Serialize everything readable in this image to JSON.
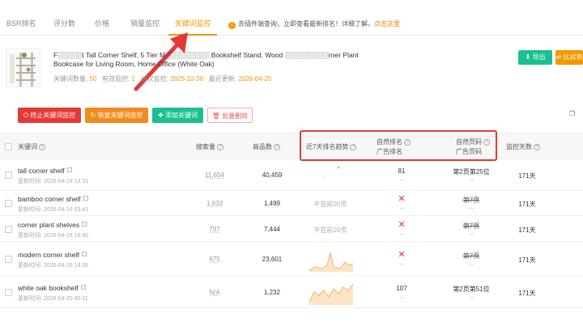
{
  "tabs": [
    "BSR排名",
    "评分数",
    "价格",
    "销量监控",
    "关键词监控"
  ],
  "notice": {
    "text": "去插件端查询，立即查看最新排名！详细了解。",
    "link": "点击这里"
  },
  "product": {
    "title_line1": "F░░░░░t Tall Corner Shelf, 5 Tier M░░░░░░░░░ Bookshelf Stand, Wood ░░░░░░░░░rner Plant",
    "title_line2": "Bookcase for Living Room, Home Office (White Oak)",
    "meta": {
      "kw_count_label": "关键词数量:",
      "kw_count": "50",
      "active_label": "有效监控:",
      "active": "1",
      "first_label": "初次监控:",
      "first": "2025-10-30",
      "last_label": "最近更新:",
      "last": "2026-04-20"
    }
  },
  "header_buttons": {
    "export": "导出",
    "compare": "比对表"
  },
  "toolbar": {
    "stop": "终止关键词监控",
    "resume": "恢复关键词监控",
    "add": "添加关键词",
    "delete": "批量删除"
  },
  "columns": {
    "keyword": "关键词",
    "search_volume": "搜索量",
    "goods_count": "商品数",
    "trend": "近7天排名趋势",
    "organic_rank": "自然排名",
    "ad_rank": "广告排名",
    "organic_page": "自然页码",
    "ad_page": "广告页码",
    "days": "监控天数"
  },
  "rows": [
    {
      "keyword": "tall corner shelf",
      "updated": "更新时间: 2026-04-19 13:31",
      "search_volume": "11,654",
      "goods": "40,459",
      "trend_text": "",
      "organic_rank": "81",
      "ad_rank": "--",
      "organic_page": "第2页第25位",
      "ad_page": "--",
      "days": "171天",
      "rank_x": false,
      "page_strike": false
    },
    {
      "keyword": "bamboo corner shelf",
      "updated": "更新时间: 2026-04-19 03:41",
      "search_volume": "1,633",
      "goods": "1,499",
      "trend_text": "不在前20页",
      "organic_rank": "",
      "ad_rank": "--",
      "organic_page": "第7页",
      "ad_page": "--",
      "days": "171天",
      "rank_x": true,
      "page_strike": true
    },
    {
      "keyword": "corner plant shelves",
      "updated": "更新时间: 2026-04-19 15:30",
      "search_volume": "797",
      "goods": "7,444",
      "trend_text": "不在前20页",
      "organic_rank": "",
      "ad_rank": "--",
      "organic_page": "第7页",
      "ad_page": "--",
      "days": "171天",
      "rank_x": true,
      "page_strike": true
    },
    {
      "keyword": "modern corner shelf",
      "updated": "更新时间: 2026-04-19 18:35",
      "search_volume": "675",
      "goods": "23,601",
      "trend_text": "",
      "organic_rank": "",
      "ad_rank": "--",
      "organic_page": "第7页",
      "ad_page": "--",
      "days": "171天",
      "rank_x": true,
      "page_strike": true
    },
    {
      "keyword": "white oak bookshelf",
      "updated": "更新时间: 2026-04-20 00:11",
      "search_volume": "N/A",
      "goods": "1,232",
      "trend_text": "",
      "organic_rank": "107",
      "ad_rank": "--",
      "organic_page": "第2页第51位",
      "ad_page": "--",
      "days": "171天",
      "rank_x": false,
      "page_strike": false
    }
  ],
  "colors": {
    "accent": "#f39800",
    "red": "#e53935",
    "green": "#1cbf91",
    "orange": "#f08c1b"
  }
}
